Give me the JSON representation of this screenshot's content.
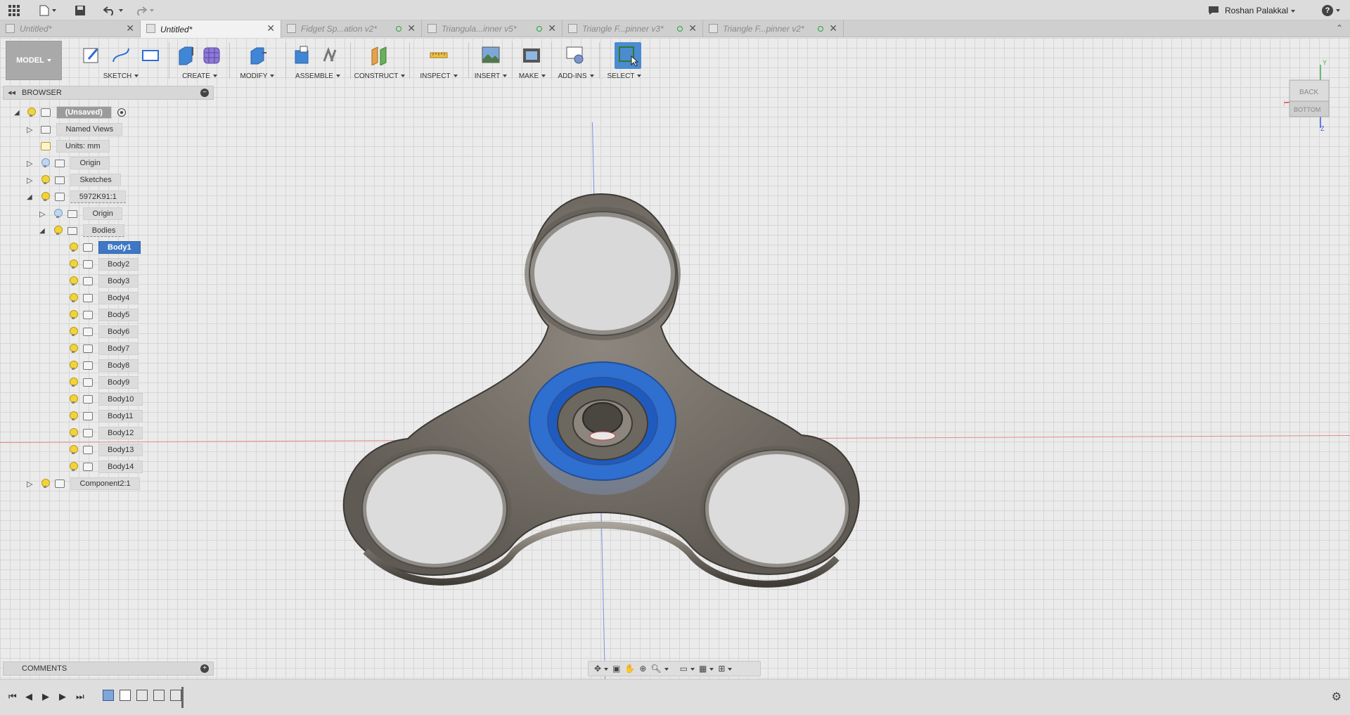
{
  "appbar": {
    "user_name": "Roshan Palakkal",
    "help_label": "?"
  },
  "tabs": [
    {
      "label": "Untitled*",
      "active": false
    },
    {
      "label": "Untitled*",
      "active": true
    },
    {
      "label": "Fidget Sp...ation v2*",
      "active": false
    },
    {
      "label": "Triangula...inner v5*",
      "active": false
    },
    {
      "label": "Triangle F...pinner v3*",
      "active": false
    },
    {
      "label": "Triangle F...pinner v2*",
      "active": false
    }
  ],
  "toolbar": {
    "workspace": "MODEL",
    "groups": [
      "SKETCH",
      "CREATE",
      "MODIFY",
      "ASSEMBLE",
      "CONSTRUCT",
      "INSPECT",
      "INSERT",
      "MAKE",
      "ADD-INS",
      "SELECT"
    ]
  },
  "browser": {
    "title": "BROWSER",
    "root": "(Unsaved)",
    "named_views": "Named Views",
    "units": "Units: mm",
    "origin": "Origin",
    "sketches": "Sketches",
    "component1": "5972K91:1",
    "sub_origin": "Origin",
    "bodies": "Bodies",
    "body_items": [
      "Body1",
      "Body2",
      "Body3",
      "Body4",
      "Body5",
      "Body6",
      "Body7",
      "Body8",
      "Body9",
      "Body10",
      "Body11",
      "Body12",
      "Body13",
      "Body14"
    ],
    "selected_body": "Body1",
    "component2": "Component2:1"
  },
  "comments": {
    "title": "COMMENTS"
  },
  "viewcube": {
    "back": "BACK",
    "bottom": "BOTTOM",
    "x_axis": "X",
    "y_axis": "Y",
    "z_axis": "Z"
  },
  "colors": {
    "accent": "#3e78c5",
    "body_metal": "#7a746c",
    "bearing": "#2f6fd0"
  }
}
